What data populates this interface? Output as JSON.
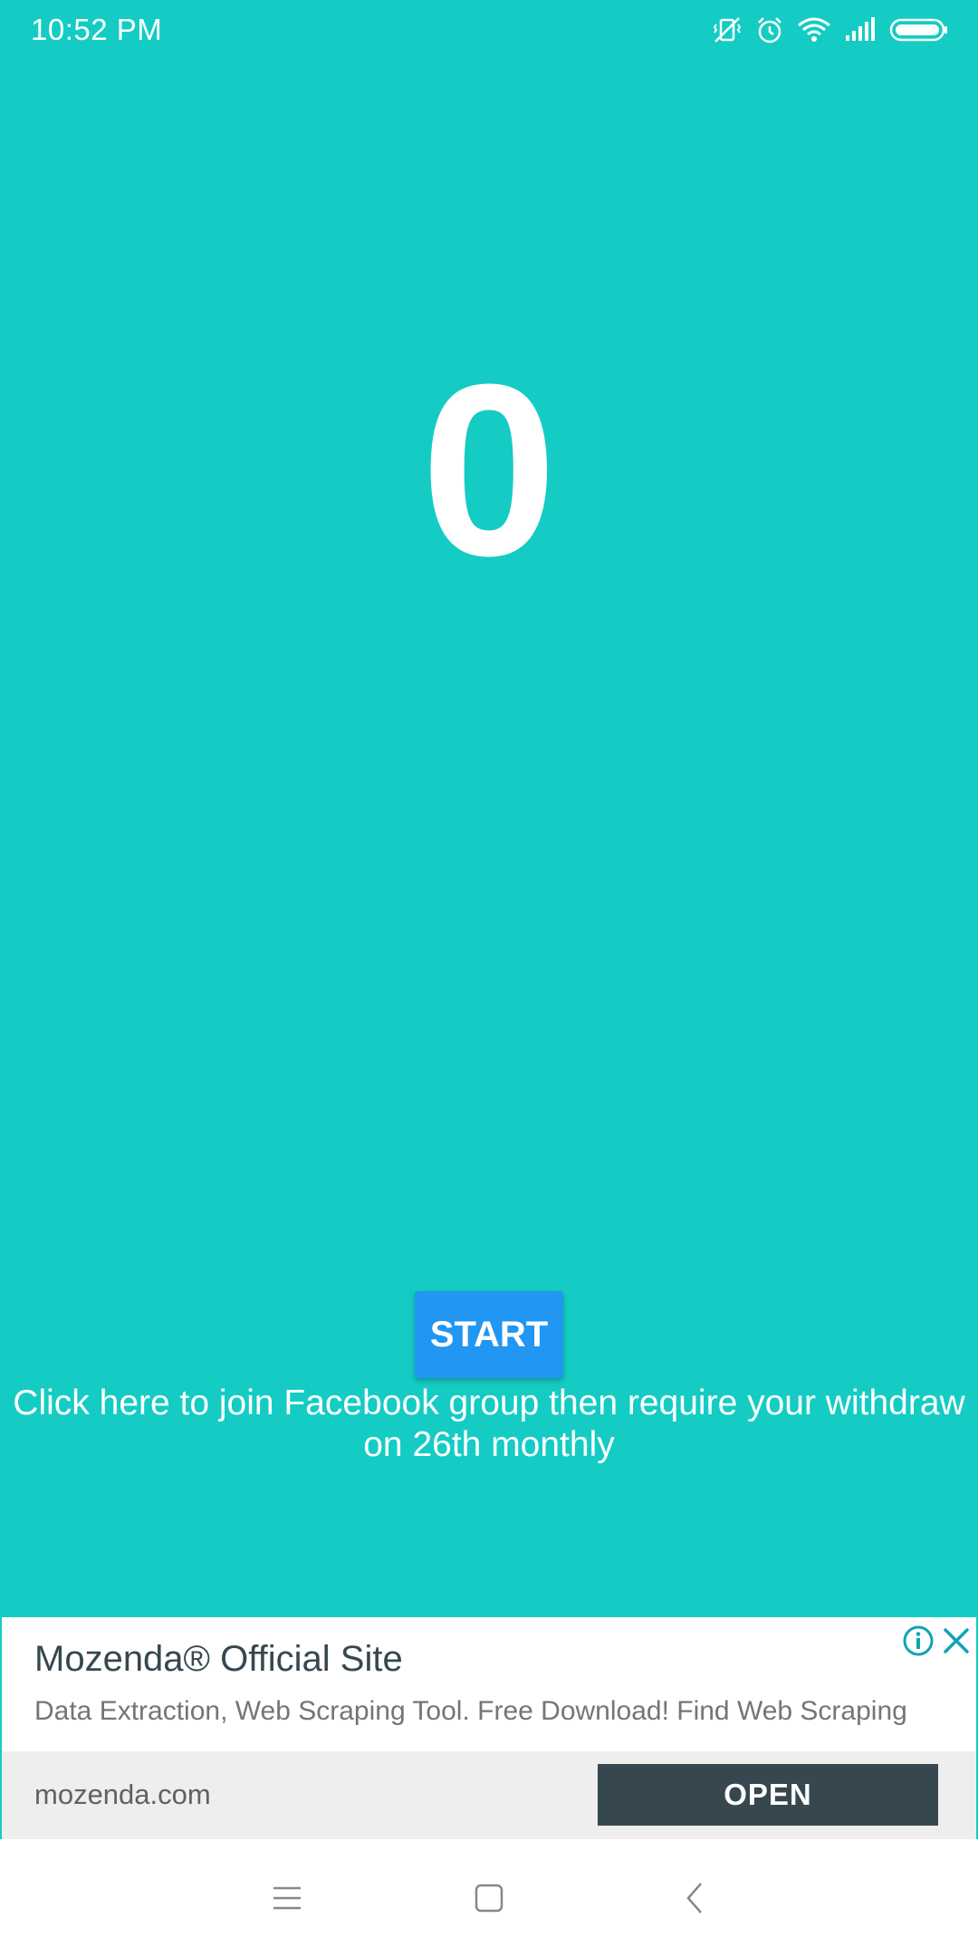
{
  "status_bar": {
    "time": "10:52  PM",
    "icons": [
      "vibrate-off-icon",
      "alarm-icon",
      "wifi-icon",
      "signal-icon",
      "battery-icon"
    ]
  },
  "counter": {
    "value": "0"
  },
  "start_button": {
    "label": "START"
  },
  "facebook_link": {
    "text": "Click here to join Facebook group then require your withdraw on 26th monthly"
  },
  "ad": {
    "title": "Mozenda® Official Site",
    "description": "Data Extraction, Web Scraping Tool. Free Download! Find Web Scraping",
    "domain": "mozenda.com",
    "cta_label": "OPEN"
  },
  "nav_bar": {
    "buttons": [
      "menu-icon",
      "home-icon",
      "back-icon"
    ]
  },
  "colors": {
    "background": "#14CCC4",
    "button": "#2196F3",
    "ad_cta": "#37474F",
    "ad_accent": "#0FA3B8"
  }
}
